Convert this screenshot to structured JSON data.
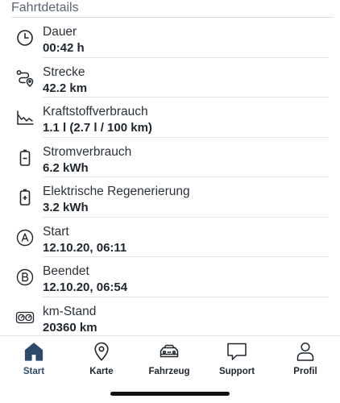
{
  "section": {
    "title": "Fahrtdetails"
  },
  "details": [
    {
      "icon": "clock-icon",
      "label": "Dauer",
      "value": "00:42 h"
    },
    {
      "icon": "route-icon",
      "label": "Strecke",
      "value": "42.2 km"
    },
    {
      "icon": "consumption-chart-icon",
      "label": "Kraftstoffverbrauch",
      "value": "1.1 l (2.7 l / 100 km)"
    },
    {
      "icon": "battery-minus-icon",
      "label": "Stromverbrauch",
      "value": "6.2 kWh"
    },
    {
      "icon": "battery-plus-icon",
      "label": "Elektrische Regenerierung",
      "value": "3.2 kWh"
    },
    {
      "icon": "start-a-icon",
      "label": "Start",
      "value": "12.10.20, 06:11"
    },
    {
      "icon": "end-b-icon",
      "label": "Beendet",
      "value": "12.10.20, 06:54"
    },
    {
      "icon": "odometer-icon",
      "label": "km-Stand",
      "value": "20360 km"
    }
  ],
  "tabbar": {
    "active": "Start",
    "accent_color": "#2e4a6b",
    "tabs": [
      {
        "icon": "home-icon",
        "label": "Start"
      },
      {
        "icon": "map-pin-icon",
        "label": "Karte"
      },
      {
        "icon": "car-icon",
        "label": "Fahrzeug"
      },
      {
        "icon": "chat-icon",
        "label": "Support"
      },
      {
        "icon": "profile-icon",
        "label": "Profil"
      }
    ]
  }
}
